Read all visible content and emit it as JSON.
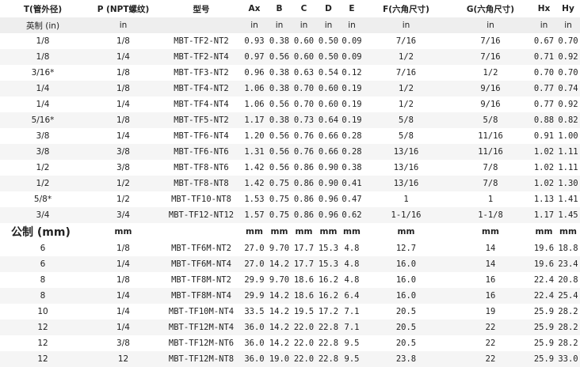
{
  "headers": [
    "T(管外径)",
    "P (NPT螺纹)",
    "型号",
    "Ax",
    "B",
    "C",
    "D",
    "E",
    "F(六角尺寸)",
    "G(六角尺寸)",
    "Hx",
    "Hy"
  ],
  "imperial_units": [
    "英制 (in)",
    "in",
    "",
    "in",
    "in",
    "in",
    "in",
    "in",
    "in",
    "in",
    "in",
    "in"
  ],
  "imperial_rows": [
    [
      "1/8",
      "1/8",
      "MBT-TF2-NT2",
      "0.93",
      "0.38",
      "0.60",
      "0.50",
      "0.09",
      "7/16",
      "7/16",
      "0.67",
      "0.70"
    ],
    [
      "1/8",
      "1/4",
      "MBT-TF2-NT4",
      "0.97",
      "0.56",
      "0.60",
      "0.50",
      "0.09",
      "1/2",
      "7/16",
      "0.71",
      "0.92"
    ],
    [
      "3/16*",
      "1/8",
      "MBT-TF3-NT2",
      "0.96",
      "0.38",
      "0.63",
      "0.54",
      "0.12",
      "7/16",
      "1/2",
      "0.70",
      "0.70"
    ],
    [
      "1/4",
      "1/8",
      "MBT-TF4-NT2",
      "1.06",
      "0.38",
      "0.70",
      "0.60",
      "0.19",
      "1/2",
      "9/16",
      "0.77",
      "0.74"
    ],
    [
      "1/4",
      "1/4",
      "MBT-TF4-NT4",
      "1.06",
      "0.56",
      "0.70",
      "0.60",
      "0.19",
      "1/2",
      "9/16",
      "0.77",
      "0.92"
    ],
    [
      "5/16*",
      "1/8",
      "MBT-TF5-NT2",
      "1.17",
      "0.38",
      "0.73",
      "0.64",
      "0.19",
      "5/8",
      "5/8",
      "0.88",
      "0.82"
    ],
    [
      "3/8",
      "1/4",
      "MBT-TF6-NT4",
      "1.20",
      "0.56",
      "0.76",
      "0.66",
      "0.28",
      "5/8",
      "11/16",
      "0.91",
      "1.00"
    ],
    [
      "3/8",
      "3/8",
      "MBT-TF6-NT6",
      "1.31",
      "0.56",
      "0.76",
      "0.66",
      "0.28",
      "13/16",
      "11/16",
      "1.02",
      "1.11"
    ],
    [
      "1/2",
      "3/8",
      "MBT-TF8-NT6",
      "1.42",
      "0.56",
      "0.86",
      "0.90",
      "0.38",
      "13/16",
      "7/8",
      "1.02",
      "1.11"
    ],
    [
      "1/2",
      "1/2",
      "MBT-TF8-NT8",
      "1.42",
      "0.75",
      "0.86",
      "0.90",
      "0.41",
      "13/16",
      "7/8",
      "1.02",
      "1.30"
    ],
    [
      "5/8*",
      "1/2",
      "MBT-TF10-NT8",
      "1.53",
      "0.75",
      "0.86",
      "0.96",
      "0.47",
      "1",
      "1",
      "1.13",
      "1.41"
    ],
    [
      "3/4",
      "3/4",
      "MBT-TF12-NT12",
      "1.57",
      "0.75",
      "0.86",
      "0.96",
      "0.62",
      "1-1/16",
      "1-1/8",
      "1.17",
      "1.45"
    ]
  ],
  "metric_units": [
    "公制 (mm)",
    "mm",
    "",
    "mm",
    "mm",
    "mm",
    "mm",
    "mm",
    "mm",
    "mm",
    "mm",
    "mm"
  ],
  "metric_rows": [
    [
      "6",
      "1/8",
      "MBT-TF6M-NT2",
      "27.0",
      "9.70",
      "17.7",
      "15.3",
      "4.8",
      "12.7",
      "14",
      "19.6",
      "18.8"
    ],
    [
      "6",
      "1/4",
      "MBT-TF6M-NT4",
      "27.0",
      "14.2",
      "17.7",
      "15.3",
      "4.8",
      "16.0",
      "14",
      "19.6",
      "23.4"
    ],
    [
      "8",
      "1/8",
      "MBT-TF8M-NT2",
      "29.9",
      "9.70",
      "18.6",
      "16.2",
      "4.8",
      "16.0",
      "16",
      "22.4",
      "20.8"
    ],
    [
      "8",
      "1/4",
      "MBT-TF8M-NT4",
      "29.9",
      "14.2",
      "18.6",
      "16.2",
      "6.4",
      "16.0",
      "16",
      "22.4",
      "25.4"
    ],
    [
      "10",
      "1/4",
      "MBT-TF10M-NT4",
      "33.5",
      "14.2",
      "19.5",
      "17.2",
      "7.1",
      "20.5",
      "19",
      "25.9",
      "28.2"
    ],
    [
      "12",
      "1/4",
      "MBT-TF12M-NT4",
      "36.0",
      "14.2",
      "22.0",
      "22.8",
      "7.1",
      "20.5",
      "22",
      "25.9",
      "28.2"
    ],
    [
      "12",
      "3/8",
      "MBT-TF12M-NT6",
      "36.0",
      "14.2",
      "22.0",
      "22.8",
      "9.5",
      "20.5",
      "22",
      "25.9",
      "28.2"
    ],
    [
      "12",
      "12",
      "MBT-TF12M-NT8",
      "36.0",
      "19.0",
      "22.0",
      "22.8",
      "9.5",
      "23.8",
      "22",
      "25.9",
      "33.0"
    ]
  ]
}
